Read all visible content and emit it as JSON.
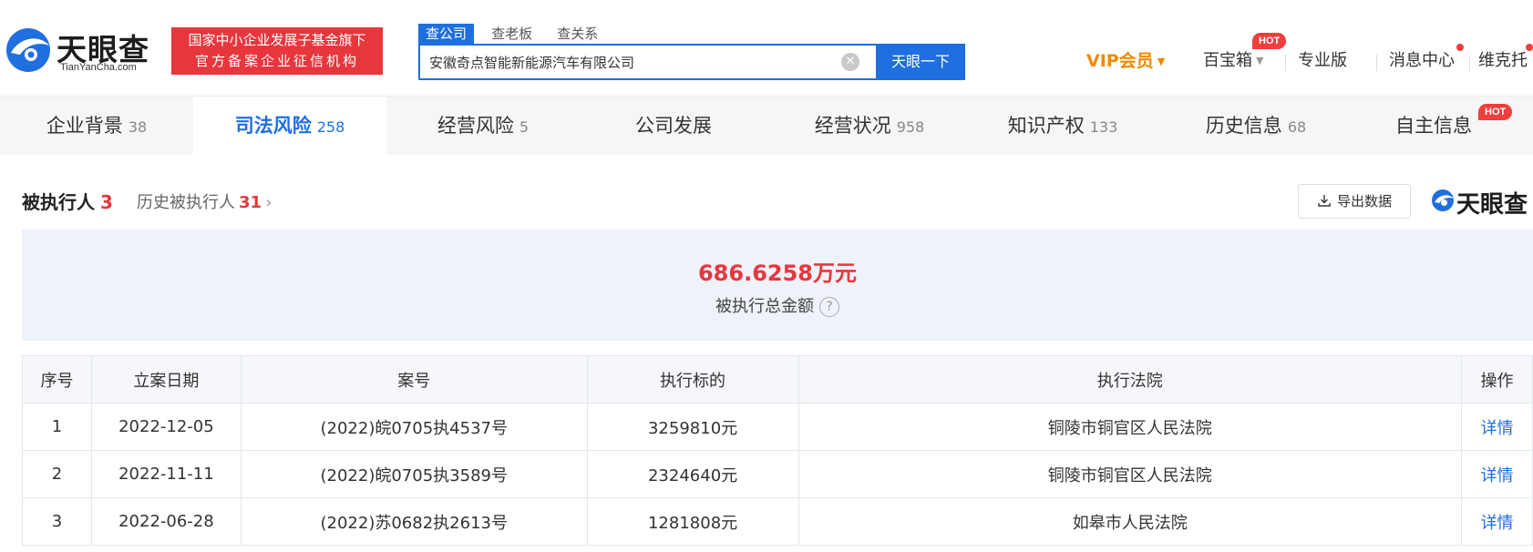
{
  "header": {
    "logo_text": "天眼查",
    "logo_sub": "TianYanCha.com",
    "badge_line1": "国家中小企业发展子基金旗下",
    "badge_line2": "官方备案企业征信机构",
    "search_tabs": [
      "查公司",
      "查老板",
      "查关系"
    ],
    "search_value": "安徽奇点智能新能源汽车有限公司",
    "search_button": "天眼一下",
    "nav": {
      "vip": "VIP会员",
      "baibaoxiang": "百宝箱",
      "hot": "HOT",
      "pro": "专业版",
      "messages": "消息中心",
      "user": "维克托"
    }
  },
  "tabs": [
    {
      "label": "企业背景",
      "count": "38"
    },
    {
      "label": "司法风险",
      "count": "258"
    },
    {
      "label": "经营风险",
      "count": "5"
    },
    {
      "label": "公司发展",
      "count": ""
    },
    {
      "label": "经营状况",
      "count": "958"
    },
    {
      "label": "知识产权",
      "count": "133"
    },
    {
      "label": "历史信息",
      "count": "68"
    },
    {
      "label": "自主信息",
      "count": ""
    }
  ],
  "tab_hot": "HOT",
  "section": {
    "title": "被执行人",
    "count": "3",
    "history_label": "历史被执行人",
    "history_count": "31",
    "export_label": "导出数据",
    "brand": "天眼查"
  },
  "summary": {
    "amount": "686.6258万元",
    "label": "被执行总金额"
  },
  "table": {
    "headers": [
      "序号",
      "立案日期",
      "案号",
      "执行标的",
      "执行法院",
      "操作"
    ],
    "rows": [
      [
        "1",
        "2022-12-05",
        "(2022)皖0705执4537号",
        "3259810元",
        "铜陵市铜官区人民法院",
        "详情"
      ],
      [
        "2",
        "2022-11-11",
        "(2022)皖0705执3589号",
        "2324640元",
        "铜陵市铜官区人民法院",
        "详情"
      ],
      [
        "3",
        "2022-06-28",
        "(2022)苏0682执2613号",
        "1281808元",
        "如皋市人民法院",
        "详情"
      ]
    ]
  },
  "colors": {
    "brand_blue": "#1f6fde",
    "accent_red": "#e8363d",
    "vip_orange": "#f08a00"
  }
}
